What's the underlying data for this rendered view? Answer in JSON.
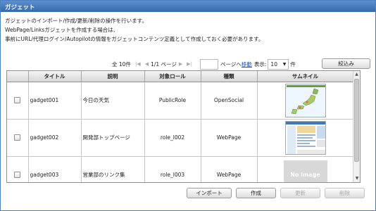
{
  "window": {
    "title": "ガジェット"
  },
  "description": [
    "ガジェットのインポート/作成/更新/削除の操作を行います。",
    "WebPage/Linksガジェットを作成する場合は、",
    "事前にURL/代理ログイン/Autopilotの情報をガジェットコンテンツ定義として作成しておく必要があります。"
  ],
  "pager": {
    "total": "全 10件",
    "page_info": "1/1 ページ",
    "goto_suffix": "ページへ",
    "goto_link": "移動",
    "display_label": "表示:",
    "per_page": "10",
    "per_page_unit": "件",
    "filter_button": "絞込み",
    "icons": {
      "first": "first-page-icon",
      "prev": "prev-page-icon",
      "next": "next-page-icon",
      "last": "last-page-icon"
    }
  },
  "table": {
    "columns": [
      "",
      "タイトル",
      "説明",
      "対象ロール",
      "種類",
      "サムネイル"
    ],
    "rows": [
      {
        "title": "gadget001",
        "description": "今日の天気",
        "role": "PublicRole",
        "type": "OpenSocial",
        "thumbnail": "japan-map-thumbnail"
      },
      {
        "title": "gadget002",
        "description": "開発部トップページ",
        "role": "role_l002",
        "type": "WebPage",
        "thumbnail": "webpage-screenshot-thumbnail"
      },
      {
        "title": "gadget003",
        "description": "営業部のリンク集",
        "role": "role_l003",
        "type": "WebPage",
        "thumbnail_text": "No image"
      }
    ]
  },
  "actions": {
    "import": "インポート",
    "create": "作成",
    "update": "更新",
    "delete": "削除"
  },
  "colors": {
    "titlebar": "#3f77bd",
    "link": "#1a4fb0"
  }
}
